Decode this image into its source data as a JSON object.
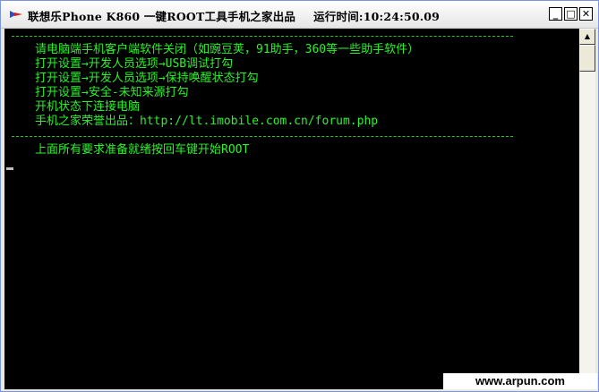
{
  "window": {
    "title": "联想乐Phone K860 一键ROOT工具手机之家出品",
    "clock": "运行时间:10:24:50.09",
    "controls": {
      "minimize": "_",
      "maximize": "□",
      "close": "✕"
    }
  },
  "console": {
    "lines": [
      "请电脑端手机客户端软件关闭（如豌豆荚，91助手，360等一些助手软件）",
      "打开设置→开发人员选项→USB调试打勾",
      "打开设置→开发人员选项→保持唤醒状态打勾",
      "打开设置→安全-未知来源打勾",
      "开机状态下连接电脑",
      "手机之家荣誉出品：http://lt.imobile.com.cn/forum.php",
      "上面所有要求准备就绪按回车键开始ROOT"
    ]
  },
  "scrollbar": {
    "up": "▲",
    "down": "▼"
  },
  "watermark": "www.arpun.com",
  "colors": {
    "console_text": "#2cf02c",
    "console_bg": "#000000"
  }
}
